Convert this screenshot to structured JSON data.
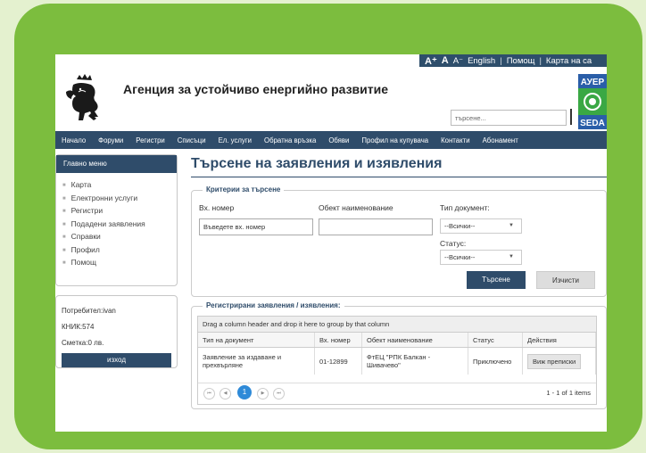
{
  "topbar": {
    "font_large": "A⁺",
    "font_normal": "A",
    "font_small": "A⁻",
    "lang": "English",
    "help": "Помощ",
    "sitemap": "Карта на са"
  },
  "header": {
    "agency_name": "Агенция за устойчиво енергийно развитие",
    "search_placeholder": "търсене...",
    "logo_top": "АУЕР",
    "logo_bottom": "SEDA"
  },
  "nav": [
    "Начало",
    "Форуми",
    "Регистри",
    "Списъци",
    "Ел. услуги",
    "Обратна връзка",
    "Обяви",
    "Профил на купувача",
    "Контакти",
    "Абонамент"
  ],
  "sidebar": {
    "title": "Главно меню",
    "items": [
      "Карта",
      "Електронни услуги",
      "Регистри",
      "Подадени заявления",
      "Справки",
      "Профил",
      "Помощ"
    ]
  },
  "user": {
    "name": "Потребител:ivan",
    "knik": "КНИК:574",
    "account": "Сметка:0 лв.",
    "logout": "изход"
  },
  "page": {
    "title": "Търсене на заявления и изявления"
  },
  "criteria": {
    "legend": "Критерии за търсене",
    "in_no_label": "Вх. номер",
    "in_no_placeholder": "Въведете вх. номер",
    "object_label": "Обект наименование",
    "doctype_label": "Тип документ:",
    "doctype_value": "--Всички--",
    "status_label": "Статус:",
    "status_value": "--Всички--",
    "search_btn": "Търсене",
    "clear_btn": "Изчисти"
  },
  "results": {
    "legend": "Регистрирани заявления / изявления:",
    "group_hint": "Drag a column header and drop it here to group by that column",
    "columns": [
      "Тип на документ",
      "Вх. номер",
      "Обект наименование",
      "Статус",
      "Действия"
    ],
    "rows": [
      {
        "type": "Заявление за издаване и прехвърляне",
        "number": "01-12899",
        "object": "ФтЕЦ \"РПК Балкан - Шивачево\"",
        "status": "Приключено",
        "action": "Виж преписки"
      }
    ],
    "pager": {
      "current": "1",
      "info": "1 - 1 of 1 items"
    }
  },
  "colors": {
    "frame": "#7cbd3e",
    "navy": "#2f4c6a",
    "pager_active": "#2e8ad8",
    "background": "#e4f1cf"
  },
  "icons": {
    "pager_first": "first-page-icon",
    "pager_prev": "prev-page-icon",
    "pager_next": "next-page-icon",
    "pager_last": "last-page-icon",
    "lion": "lion-coat-of-arms-icon"
  }
}
